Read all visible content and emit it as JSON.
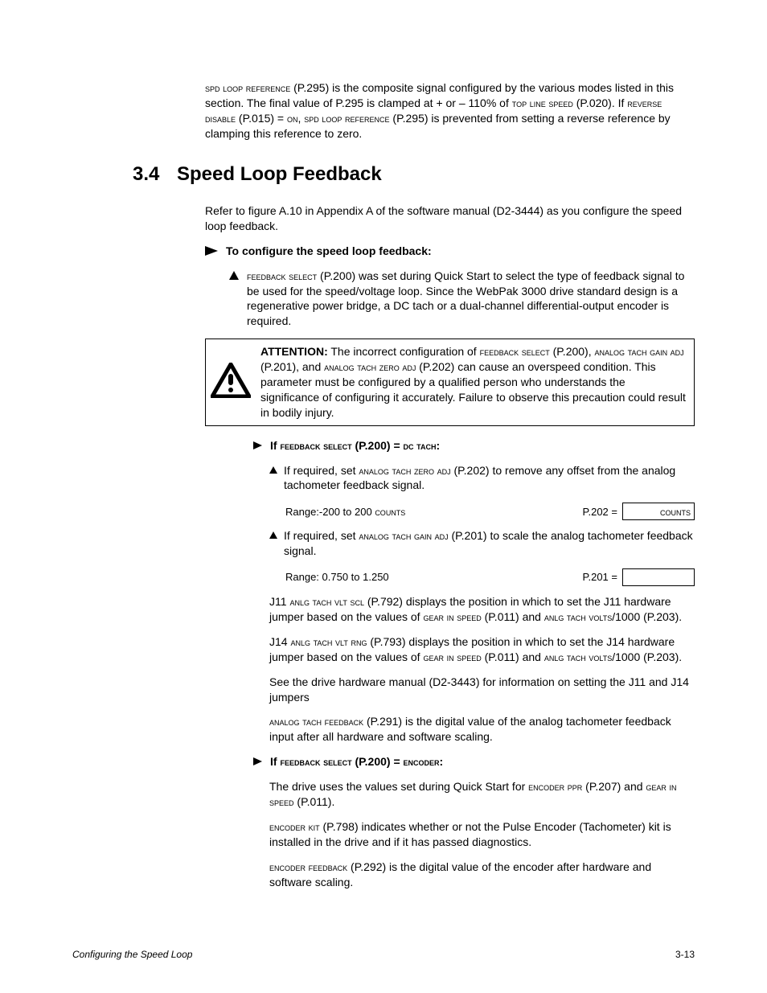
{
  "intro": {
    "part1": "spd loop reference",
    "part2": " (P.295) is the composite signal configured by the various modes listed in this section. The final value of P.295 is clamped at + or – 110% of ",
    "part3": "top line speed",
    "part4": " (P.020). If ",
    "part5": "reverse disable",
    "part6": " (P.015) = ",
    "part7": "on",
    "part8": ", ",
    "part9": "spd loop reference",
    "part10": " (P.295) is prevented from setting a reverse reference by clamping this reference to zero."
  },
  "section": {
    "number": "3.4",
    "title": "Speed Loop Feedback"
  },
  "refText": "Refer to figure A.10 in Appendix A of the software manual (D2-3444) as you configure the speed loop feedback.",
  "configureHeading": "To configure the speed loop feedback:",
  "step1": {
    "p1": "feedback select",
    "p2": " (P.200) was set during Quick Start to select the type of feedback signal to be used for the speed/voltage loop. Since the WebPak 3000 drive standard design is a regenerative power bridge, a DC tach or a dual-channel differential-output encoder is required."
  },
  "attention": {
    "label": "ATTENTION:",
    "t1": " The incorrect configuration of ",
    "t2": "feedback select",
    "t3": " (P.200), ",
    "t4": "analog tach gain adj",
    "t5": " (P.201), and ",
    "t6": "analog tach zero adj",
    "t7": " (P.202) can cause an overspeed condition. This parameter must be configured by a qualified person who understands the significance of configuring it accurately. Failure to observe this precaution could result in bodily injury."
  },
  "ifDcTach": {
    "pre": "If ",
    "sc": "feedback select",
    "post": " (P.200) = ",
    "sc2": "dc tach",
    "colon": ":"
  },
  "dcStep1": {
    "t1": "If required, set ",
    "t2": "analog tach zero adj",
    "t3": " (P.202) to remove any offset from the analog tachometer feedback signal."
  },
  "range1": {
    "label": "Range:-200 to 200 ",
    "sc": "counts",
    "param": "P.202 =",
    "unit": "counts"
  },
  "dcStep2": {
    "t1": "If required, set ",
    "t2": "analog tach gain adj",
    "t3": " (P.201) to scale the analog tachometer feedback signal."
  },
  "range2": {
    "label": "Range: 0.750 to 1.250",
    "param": "P.201 ="
  },
  "j11": {
    "t1": "J11 ",
    "t2": "anlg tach vlt scl",
    "t3": " (P.792) displays the position in which to set the J11 hardware jumper based on the values of ",
    "t4": "gear in speed",
    "t5": " (P.011) and ",
    "t6": "anlg tach volts",
    "t7": "/1000 (P.203)."
  },
  "j14": {
    "t1": "J14 ",
    "t2": "anlg tach vlt rng",
    "t3": " (P.793) displays the position in which to set the J14 hardware jumper based on the values of ",
    "t4": "gear in speed",
    "t5": " (P.011) and ",
    "t6": "anlg tach volts",
    "t7": "/1000 (P.203)."
  },
  "seeDrive": "See the drive hardware manual (D2-3443) for information on setting the J11 and J14 jumpers",
  "analogFeedback": {
    "t1": "analog tach feedback",
    "t2": " (P.291) is the digital value of the analog tachometer feedback input after all hardware and software scaling."
  },
  "ifEncoder": {
    "pre": "If ",
    "sc": "feedback select",
    "post": " (P.200) = ",
    "sc2": "encoder",
    "colon": ":"
  },
  "encP1": {
    "t1": "The drive uses the values set during Quick Start for ",
    "t2": "encoder ppr",
    "t3": " (P.207) and ",
    "t4": "gear in speed",
    "t5": " (P.011)."
  },
  "encP2": {
    "t1": "encoder kit",
    "t2": " (P.798) indicates whether or not the Pulse Encoder (Tachometer) kit is installed in the drive and if it has passed diagnostics."
  },
  "encP3": {
    "t1": "encoder feedback",
    "t2": " (P.292) is the digital value of the encoder after hardware and software scaling."
  },
  "footer": {
    "left": "Configuring the Speed Loop",
    "right": "3-13"
  }
}
